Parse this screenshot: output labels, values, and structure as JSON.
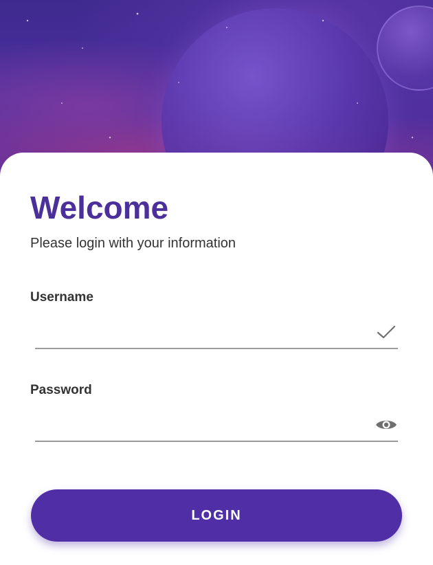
{
  "welcome": {
    "title": "Welcome",
    "subtitle": "Please login with your information"
  },
  "form": {
    "username": {
      "label": "Username",
      "value": "",
      "icon": "checkmark-icon"
    },
    "password": {
      "label": "Password",
      "value": "",
      "icon": "eye-icon"
    },
    "login_label": "LOGIN"
  },
  "colors": {
    "accent": "#4b2f9a",
    "button": "#4f2ea6",
    "text": "#333333",
    "underline": "#9a9a9a"
  }
}
